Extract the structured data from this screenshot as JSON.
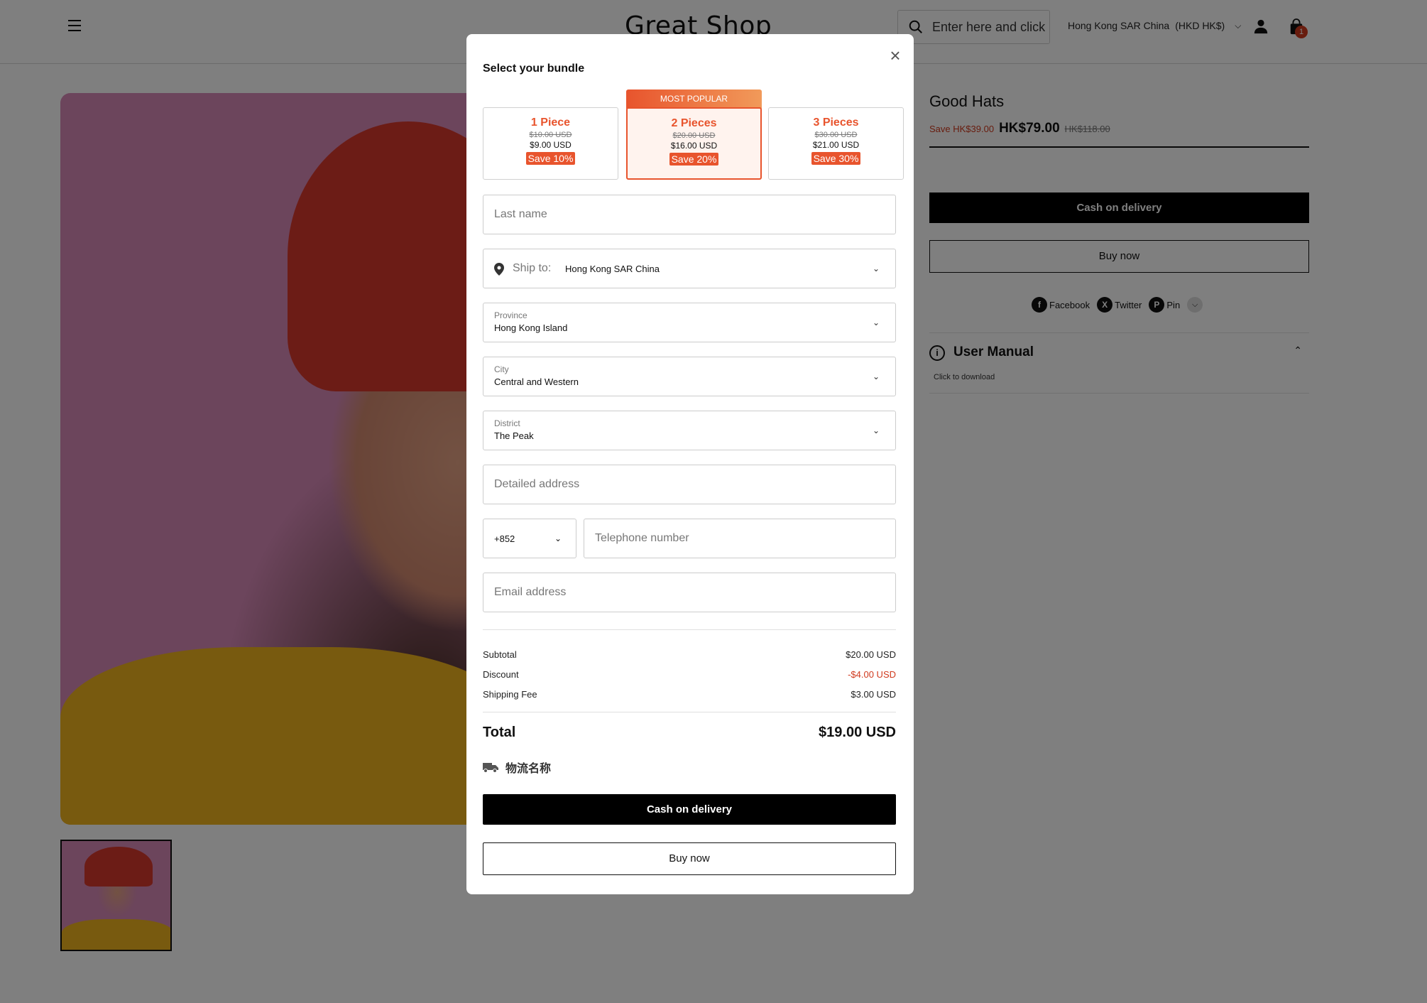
{
  "header": {
    "logo": "Great Shop",
    "search_placeholder": "Enter here and click",
    "region": "Hong Kong SAR China",
    "currency": "(HKD HK$)",
    "cart_count": "1"
  },
  "product": {
    "title": "Good Hats",
    "save_text": "Save HK$39.00",
    "price": "HK$79.00",
    "original_price": "HK$118.00",
    "cod_label": "Cash on delivery",
    "buy_label": "Buy now",
    "share": {
      "facebook": "Facebook",
      "twitter": "Twitter",
      "pin": "Pin"
    },
    "manual_title": "User Manual",
    "manual_sub": "Click to download"
  },
  "modal": {
    "title": "Select your bundle",
    "popular_badge": "MOST POPULAR",
    "bundles": [
      {
        "name": "1 Piece",
        "old": "$10.00 USD",
        "now": "$9.00 USD",
        "save": "Save 10%"
      },
      {
        "name": "2 Pieces",
        "old": "$20.00 USD",
        "now": "$16.00 USD",
        "save": "Save 20%"
      },
      {
        "name": "3 Pieces",
        "old": "$30.00 USD",
        "now": "$21.00 USD",
        "save": "Save 30%"
      }
    ],
    "form": {
      "last_name_ph": "Last name",
      "ship_to_label": "Ship to:",
      "ship_to_value": "Hong Kong SAR China",
      "province_label": "Province",
      "province_value": "Hong Kong Island",
      "city_label": "City",
      "city_value": "Central and Western",
      "district_label": "District",
      "district_value": "The Peak",
      "address_ph": "Detailed address",
      "phone_code": "+852",
      "phone_ph": "Telephone number",
      "email_ph": "Email address"
    },
    "summary": {
      "subtotal_label": "Subtotal",
      "subtotal": "$20.00 USD",
      "discount_label": "Discount",
      "discount": "-$4.00 USD",
      "shipping_label": "Shipping Fee",
      "shipping": "$3.00 USD",
      "total_label": "Total",
      "total": "$19.00 USD"
    },
    "logistics_name": "物流名称",
    "cod_label": "Cash on delivery",
    "buy_label": "Buy now"
  },
  "colors": {
    "accent": "#e8542d",
    "discount": "#d0391d"
  }
}
